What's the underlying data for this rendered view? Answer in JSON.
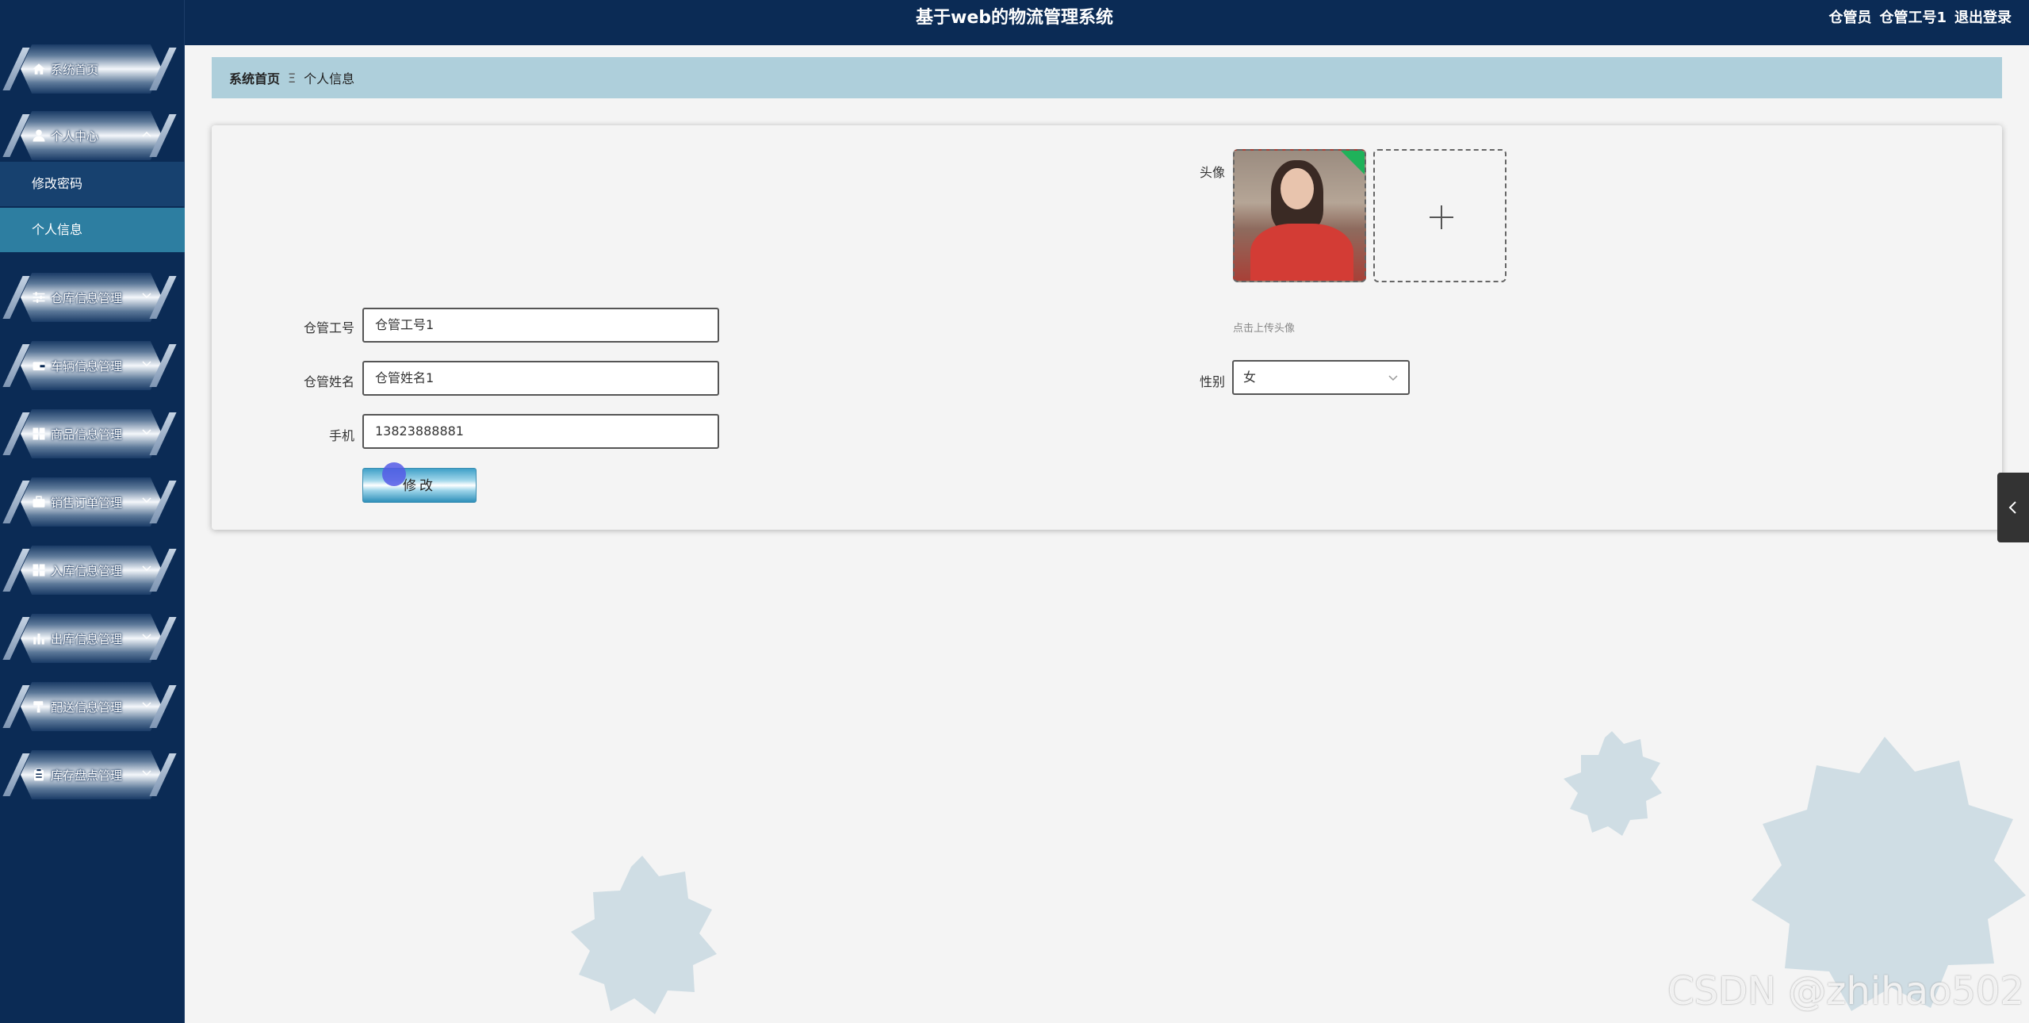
{
  "app": {
    "title": "基于web的物流管理系统",
    "role": "仓管员",
    "username": "仓管工号1",
    "logout": "退出登录"
  },
  "sidebar": {
    "items": [
      {
        "label": "系统首页",
        "icon": "home-icon"
      },
      {
        "label": "个人中心",
        "icon": "user-icon",
        "expanded": true,
        "children": [
          {
            "label": "修改密码"
          },
          {
            "label": "个人信息",
            "active": true
          }
        ]
      },
      {
        "label": "仓库信息管理",
        "icon": "sliders-icon"
      },
      {
        "label": "车辆信息管理",
        "icon": "wallet-icon"
      },
      {
        "label": "商品信息管理",
        "icon": "grid-icon"
      },
      {
        "label": "销售订单管理",
        "icon": "briefcase-icon"
      },
      {
        "label": "入库信息管理",
        "icon": "grid-icon"
      },
      {
        "label": "出库信息管理",
        "icon": "bar-chart-icon"
      },
      {
        "label": "配送信息管理",
        "icon": "paint-roller-icon"
      },
      {
        "label": "库存盘点管理",
        "icon": "clipboard-icon"
      }
    ]
  },
  "breadcrumb": {
    "home": "系统首页",
    "separator": "Ξ",
    "current": "个人信息"
  },
  "form": {
    "avatar_label": "头像",
    "upload_tip": "点击上传头像",
    "fields": {
      "id_label": "仓管工号",
      "id_value": "仓管工号1",
      "name_label": "仓管姓名",
      "name_value": "仓管姓名1",
      "phone_label": "手机",
      "phone_value": "13823888881",
      "gender_label": "性别",
      "gender_value": "女"
    },
    "submit_label": "修改"
  },
  "watermark": "CSDN @zhihao502",
  "colors": {
    "sidebar_bg": "#0b2b55",
    "breadcrumb_bg": "#aecfdb",
    "active_item": "#2d7ea1",
    "decoration": "#cfdde4"
  }
}
